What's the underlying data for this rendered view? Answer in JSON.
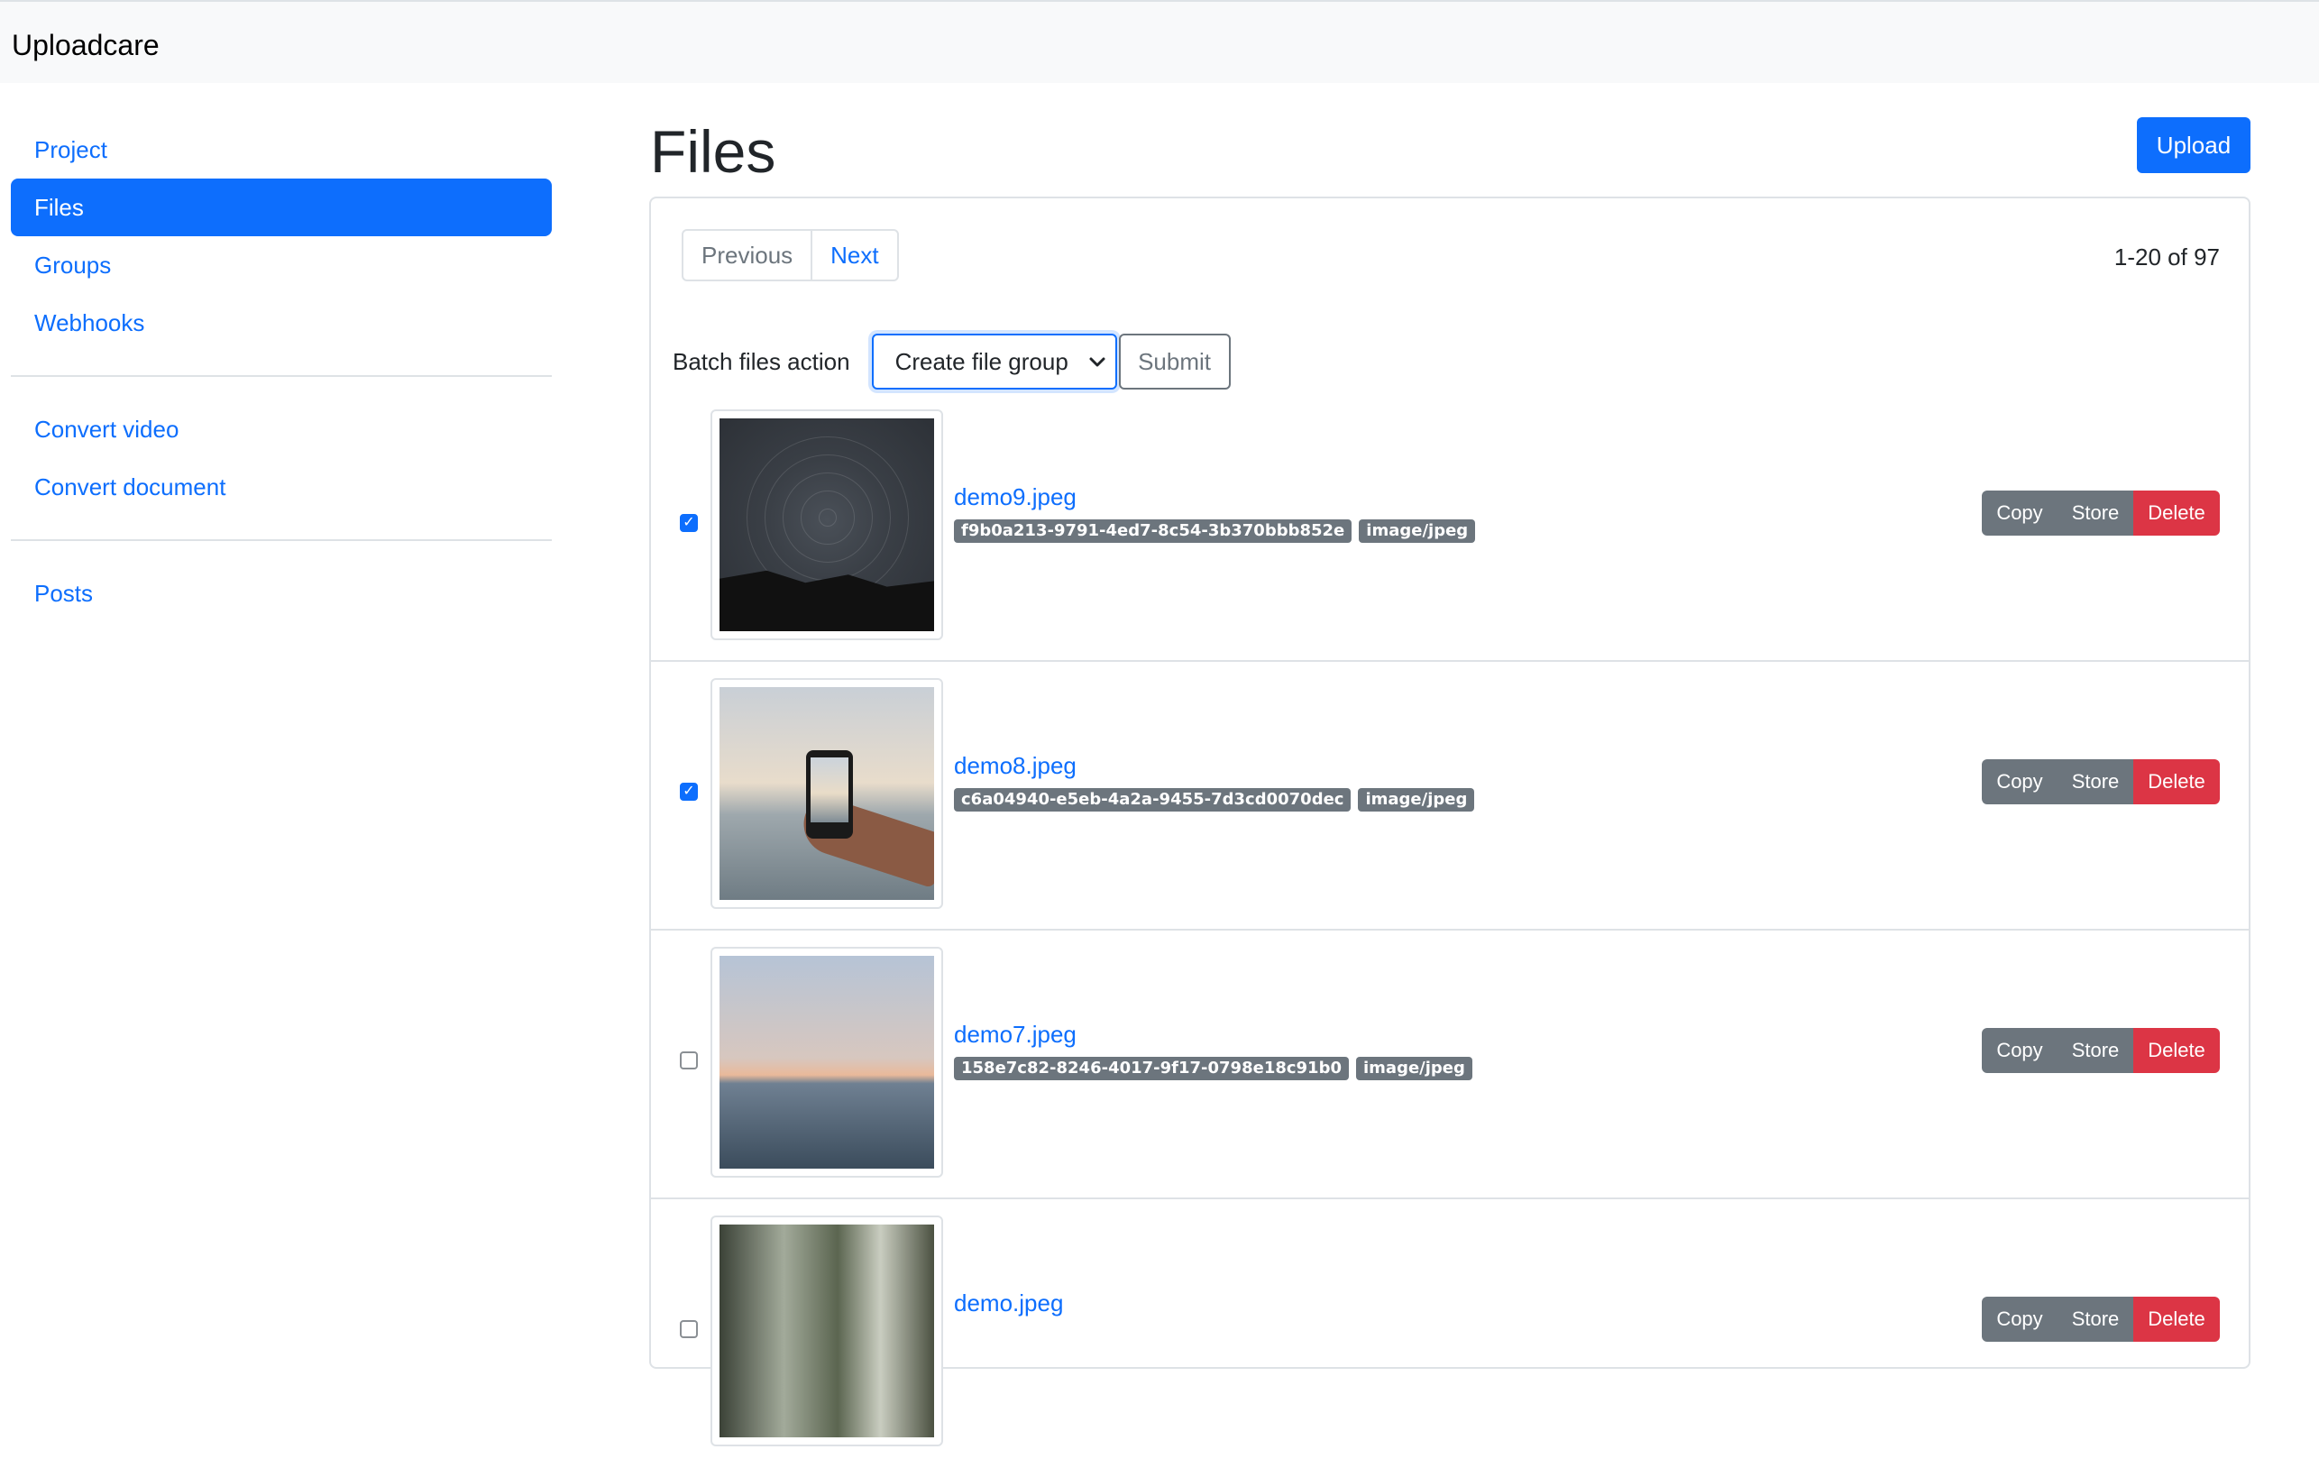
{
  "app": {
    "brand": "Uploadcare"
  },
  "sidebar": {
    "group1": [
      {
        "label": "Project",
        "active": false
      },
      {
        "label": "Files",
        "active": true
      },
      {
        "label": "Groups",
        "active": false
      },
      {
        "label": "Webhooks",
        "active": false
      }
    ],
    "group2": [
      {
        "label": "Convert video"
      },
      {
        "label": "Convert document"
      }
    ],
    "group3": [
      {
        "label": "Posts"
      }
    ]
  },
  "main": {
    "title": "Files",
    "upload_label": "Upload",
    "pagination": {
      "previous": "Previous",
      "next": "Next",
      "count": "1-20 of 97"
    },
    "batch": {
      "label": "Batch files action",
      "selected": "Create file group",
      "submit": "Submit"
    },
    "actions": {
      "copy": "Copy",
      "store": "Store",
      "delete": "Delete"
    },
    "files": [
      {
        "name": "demo9.jpeg",
        "uuid": "f9b0a213-9791-4ed7-8c54-3b370bbb852e",
        "mime": "image/jpeg",
        "checked": true
      },
      {
        "name": "demo8.jpeg",
        "uuid": "c6a04940-e5eb-4a2a-9455-7d3cd0070dec",
        "mime": "image/jpeg",
        "checked": true
      },
      {
        "name": "demo7.jpeg",
        "uuid": "158e7c82-8246-4017-9f17-0798e18c91b0",
        "mime": "image/jpeg",
        "checked": false
      },
      {
        "name": "demo.jpeg",
        "uuid": "",
        "mime": "",
        "checked": false
      }
    ]
  },
  "colors": {
    "primary": "#0d6efd",
    "secondary": "#6c757d",
    "danger": "#dc3545"
  }
}
